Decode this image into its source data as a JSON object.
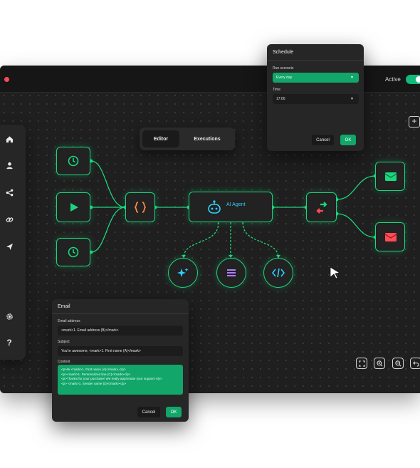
{
  "topbar": {
    "active_label": "Active"
  },
  "tabs": {
    "editor": "Editor",
    "executions": "Executions"
  },
  "workflow": {
    "agent_label": "AI Agent"
  },
  "schedule": {
    "title": "Schedule",
    "run_scenario_label": "Run scenario",
    "run_scenario_value": "Every day",
    "time_label": "Time",
    "time_value": "17:00",
    "cancel": "Cancel",
    "ok": "OK"
  },
  "email": {
    "title": "Email",
    "address_label": "Email address",
    "address_value": "<mark>1. Email address (B)</mark>",
    "subject_label": "Subject",
    "subject_value": "You're awesome, <mark>1. First name (A)</mark>",
    "content_label": "Content",
    "content_lines": [
      "<p>Hi <mark>1. First name (A)</mark>,</p>",
      "<p><mark>1. Personalized line (C)</mark></p>",
      "<p>Thanks for your purchase! We really appreciate your support.</p>",
      "<p>  <mark>1. Sender name (D)</mark></p>"
    ],
    "cancel": "Cancel",
    "ok": "OK"
  },
  "colors": {
    "accent": "#1bd67c",
    "button_green": "#12a66a",
    "agent_text": "#2fd0ff",
    "bg": "#1f1f1f",
    "panel": "#262626",
    "error_red": "#ff4b55"
  },
  "icons": [
    "home-icon",
    "user-icon",
    "share-icon",
    "link-icon",
    "send-icon",
    "gear-icon",
    "help-icon",
    "clock-icon",
    "play-icon",
    "code-braces-icon",
    "robot-icon",
    "sparkles-icon",
    "menu-icon",
    "code-icon",
    "swap-arrows-icon",
    "mail-icon",
    "fullscreen-icon",
    "zoom-in-icon",
    "zoom-out-icon",
    "undo-icon",
    "cursor-icon",
    "plus-icon"
  ]
}
